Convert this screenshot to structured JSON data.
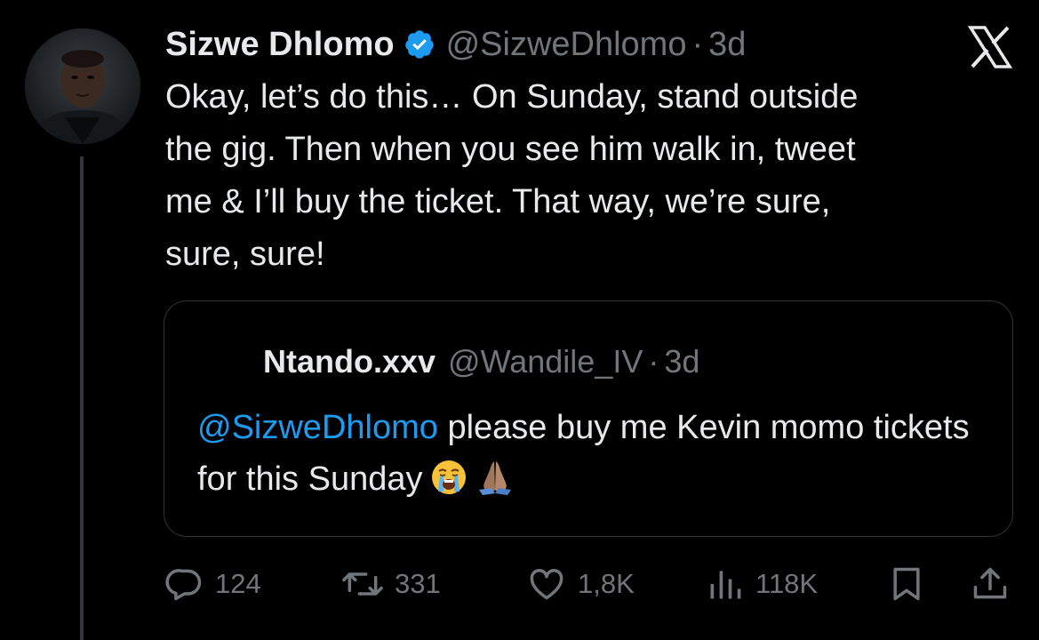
{
  "tweet": {
    "author": {
      "display_name": "Sizwe Dhlomo",
      "handle": "@SizweDhlomo",
      "separator": "·",
      "time": "3d",
      "verified": true
    },
    "text": "Okay, let’s do this… On Sunday, stand outside\nthe gig. Then when you see him walk in, tweet\nme & I’ll buy the ticket. That way, we’re sure,\nsure, sure!"
  },
  "quote": {
    "author": {
      "display_name": "Ntando.xxv",
      "handle": "@Wandile_IV",
      "separator": "·",
      "time": "3d"
    },
    "mention": "@SizweDhlomo",
    "text": " please buy me Kevin momo tickets for this Sunday",
    "emojis": [
      "loudly-crying-face-emoji",
      "folded-hands-emoji"
    ]
  },
  "actions": {
    "replies": "124",
    "reposts": "331",
    "likes": "1,8K",
    "views": "118K"
  },
  "icons": [
    "verified-badge-icon",
    "x-logo-icon",
    "reply-icon",
    "repost-icon",
    "like-icon",
    "views-icon",
    "bookmark-icon",
    "share-icon"
  ],
  "colors": {
    "background": "#000000",
    "text": "#e7e9ea",
    "secondary": "#71767b",
    "accent": "#1d9bf0",
    "border": "#2f3336"
  }
}
